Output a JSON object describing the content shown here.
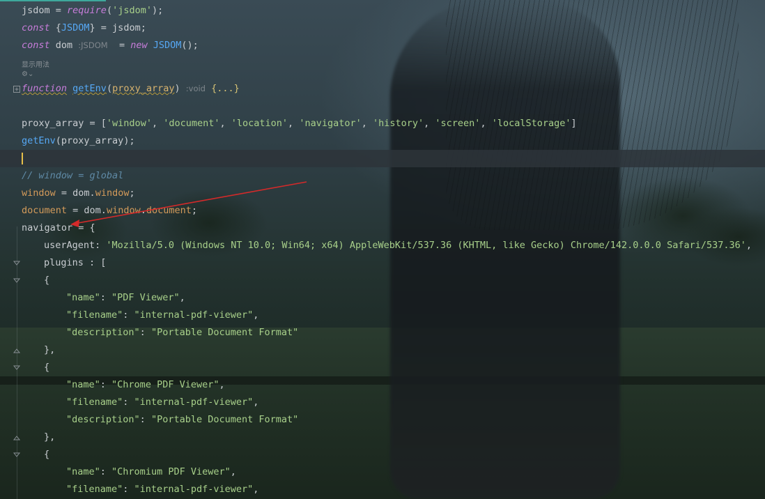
{
  "editor": {
    "hints": {
      "show_usages": "显示用法",
      "usages_icon": "⚙"
    },
    "lines": {
      "l1": [
        "jsdom",
        " = ",
        "require",
        "(",
        "'jsdom'",
        ");"
      ],
      "l2": [
        "const",
        " {",
        "JSDOM",
        "} = jsdom;"
      ],
      "l3": [
        "const",
        " dom ",
        ":JSDOM",
        "  = ",
        "new",
        " ",
        "JSDOM",
        "();"
      ],
      "l4": [
        "function",
        " ",
        "getEnv",
        "(",
        "proxy_array",
        ") ",
        ":void",
        " ",
        "{...}"
      ],
      "l5": [
        "proxy_array = [",
        "'window'",
        ", ",
        "'document'",
        ", ",
        "'location'",
        ", ",
        "'navigator'",
        ", ",
        "'history'",
        ", ",
        "'screen'",
        ", ",
        "'localStorage'",
        "]"
      ],
      "l6": [
        "getEnv",
        "(proxy_array);"
      ],
      "l7": [
        "// window = global"
      ],
      "l8": [
        "window",
        " = dom.",
        "window",
        ";"
      ],
      "l9": [
        "document",
        " = dom.",
        "window",
        ".",
        "document",
        ";"
      ],
      "l10": [
        "navigator",
        " = {"
      ],
      "l11": [
        "userAgent",
        ": ",
        "'Mozilla/5.0 (Windows NT 10.0; Win64; x64) AppleWebKit/537.36 (KHTML, like Gecko) Chrome/142.0.0.0 Safari/537.36'",
        ","
      ],
      "l12": [
        "plugins",
        " : ["
      ],
      "l13": [
        "{"
      ],
      "l14": [
        "\"name\"",
        ": ",
        "\"PDF Viewer\"",
        ","
      ],
      "l15": [
        "\"filename\"",
        ": ",
        "\"internal-pdf-viewer\"",
        ","
      ],
      "l16": [
        "\"description\"",
        ": ",
        "\"Portable Document Format\""
      ],
      "l17": [
        "},"
      ],
      "l18": [
        "{"
      ],
      "l19": [
        "\"name\"",
        ": ",
        "\"Chrome PDF Viewer\"",
        ","
      ],
      "l20": [
        "\"filename\"",
        ": ",
        "\"internal-pdf-viewer\"",
        ","
      ],
      "l21": [
        "\"description\"",
        ": ",
        "\"Portable Document Format\""
      ],
      "l22": [
        "},"
      ],
      "l23": [
        "{"
      ],
      "l24": [
        "\"name\"",
        ": ",
        "\"Chromium PDF Viewer\"",
        ","
      ],
      "l25": [
        "\"filename\"",
        ": ",
        "\"internal-pdf-viewer\"",
        ","
      ]
    },
    "colors": {
      "arrow": "#d42a2a",
      "caret": "#e6c04a"
    }
  }
}
